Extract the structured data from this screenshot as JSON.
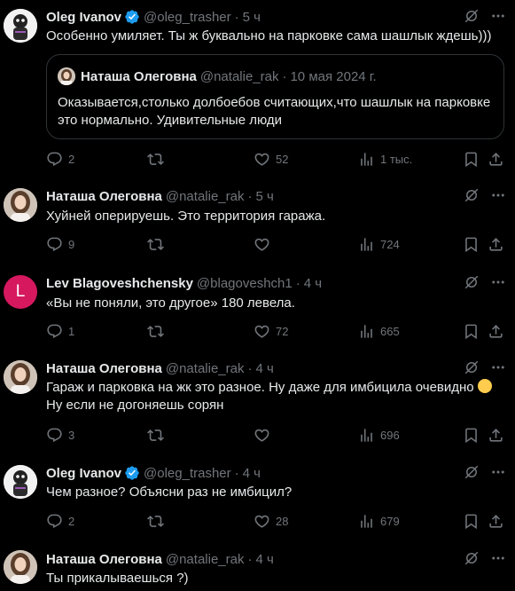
{
  "tweets": [
    {
      "name": "Oleg Ivanov",
      "verified": true,
      "handle": "@oleg_trasher",
      "time": "5 ч",
      "text": "Особенно умиляет. Ты ж буквально на парковке сама шашлык ждешь)))",
      "quote": {
        "name": "Наташа Олеговна",
        "handle": "@natalie_rak",
        "time": "10 мая 2024 г.",
        "text": "Оказывается,столько долбоебов считающих,что шашлык на парковке это нормально. Удивительные люди"
      },
      "replies": "2",
      "reposts": "",
      "likes": "52",
      "views": "1 тыс."
    },
    {
      "name": "Наташа Олеговна",
      "verified": false,
      "handle": "@natalie_rak",
      "time": "5 ч",
      "text": "Хуйней оперируешь. Это территория гаража.",
      "replies": "9",
      "reposts": "",
      "likes": "",
      "views": "724"
    },
    {
      "name": "Lev Blagoveshchensky",
      "verified": false,
      "avatar_letter": "L",
      "handle": "@blagoveshch1",
      "time": "4 ч",
      "text": "«Вы не поняли, это другое» 180 левела.",
      "replies": "1",
      "reposts": "",
      "likes": "72",
      "views": "665"
    },
    {
      "name": "Наташа Олеговна",
      "verified": false,
      "handle": "@natalie_rak",
      "time": "4 ч",
      "text_line1": "Гараж и парковка на жк это разное. Ну даже для имбицила очевидно",
      "text_line2": "Ну если не догоняешь сорян",
      "replies": "3",
      "reposts": "",
      "likes": "",
      "views": "696"
    },
    {
      "name": "Oleg Ivanov",
      "verified": true,
      "handle": "@oleg_trasher",
      "time": "4 ч",
      "text": "Чем разное? Объясни раз не имбицил?",
      "replies": "2",
      "reposts": "",
      "likes": "28",
      "views": "679"
    },
    {
      "name": "Наташа Олеговна",
      "verified": false,
      "handle": "@natalie_rak",
      "time": "4 ч",
      "text": "Ты прикалываешься ?)"
    }
  ],
  "separator": "·",
  "colors": {
    "background": "#000000",
    "text": "#e7e9ea",
    "muted": "#71767b",
    "verified": "#1d9bf0",
    "avatar_lev": "#d6185f"
  },
  "icons": [
    "grok-icon",
    "more-icon",
    "reply-icon",
    "repost-icon",
    "like-icon",
    "views-icon",
    "bookmark-icon",
    "share-icon",
    "verified-badge-icon"
  ]
}
